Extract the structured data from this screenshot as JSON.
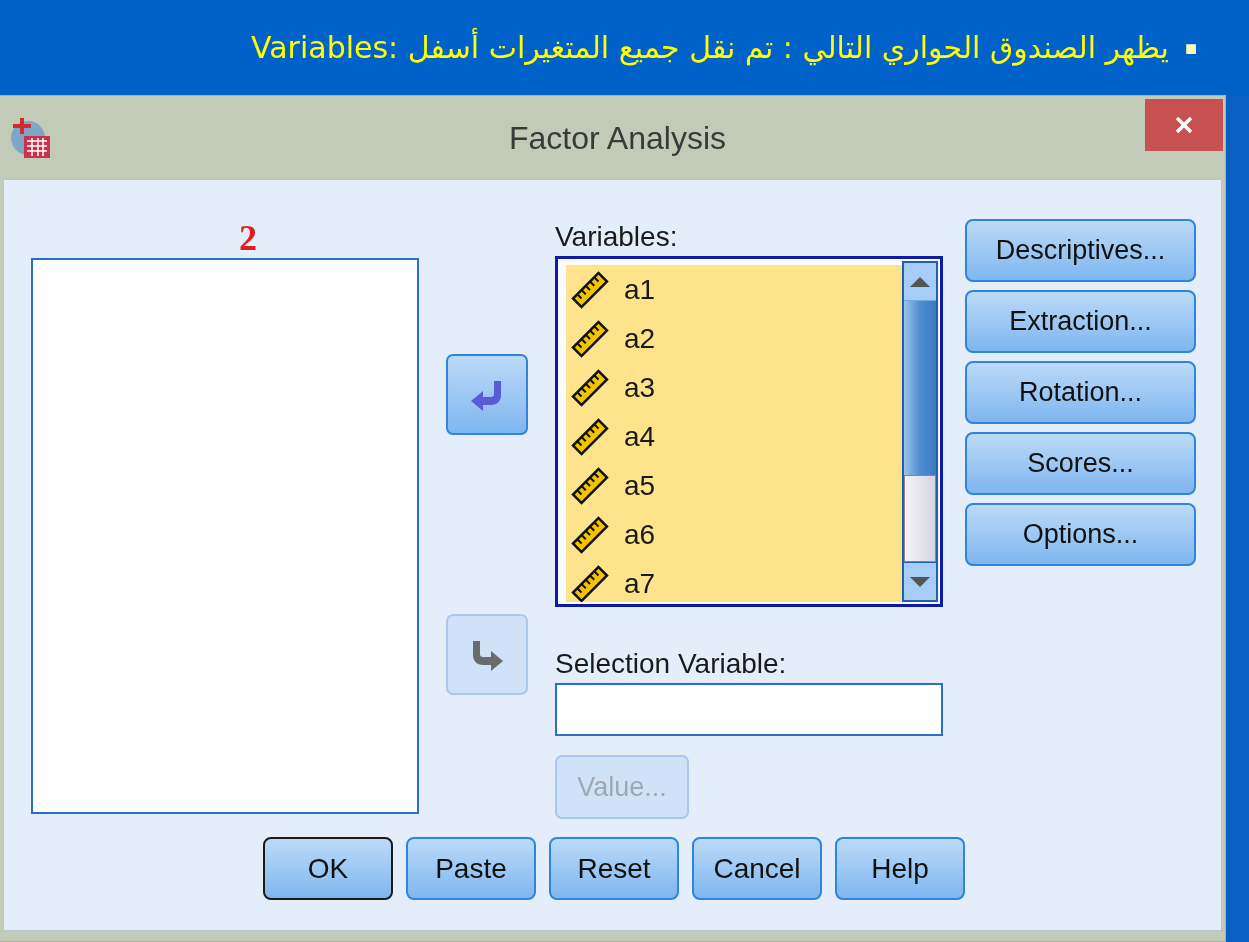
{
  "slide": {
    "bullet": "■",
    "heading": "يظهر الصندوق الحواري التالي : تم نقل جميع المتغيرات أسفل :Variables"
  },
  "dialog": {
    "title": "Factor Analysis",
    "source_list": {
      "label": "2"
    },
    "move_buttons": [
      {
        "kind": "left",
        "disabled": false
      },
      {
        "kind": "right",
        "disabled": true
      }
    ],
    "variables": {
      "label": "Variables:",
      "items": [
        {
          "name": "a1",
          "kind": "scale",
          "selected": true
        },
        {
          "name": "a2",
          "kind": "scale",
          "selected": true
        },
        {
          "name": "a3",
          "kind": "scale",
          "selected": true
        },
        {
          "name": "a4",
          "kind": "scale",
          "selected": true
        },
        {
          "name": "a5",
          "kind": "scale",
          "selected": true
        },
        {
          "name": "a6",
          "kind": "scale",
          "selected": true
        },
        {
          "name": "a7",
          "kind": "scale",
          "selected": true
        }
      ]
    },
    "selection_variable": {
      "label": "Selection Variable:",
      "value_button": {
        "label": "Value...",
        "disabled": true
      }
    },
    "side_buttons": [
      "Descriptives...",
      "Extraction...",
      "Rotation...",
      "Scores...",
      "Options..."
    ],
    "bottom_buttons": [
      {
        "label": "OK",
        "default": true
      },
      {
        "label": "Paste",
        "default": false
      },
      {
        "label": "Reset",
        "default": false
      },
      {
        "label": "Cancel",
        "default": false
      },
      {
        "label": "Help",
        "default": false
      }
    ]
  }
}
